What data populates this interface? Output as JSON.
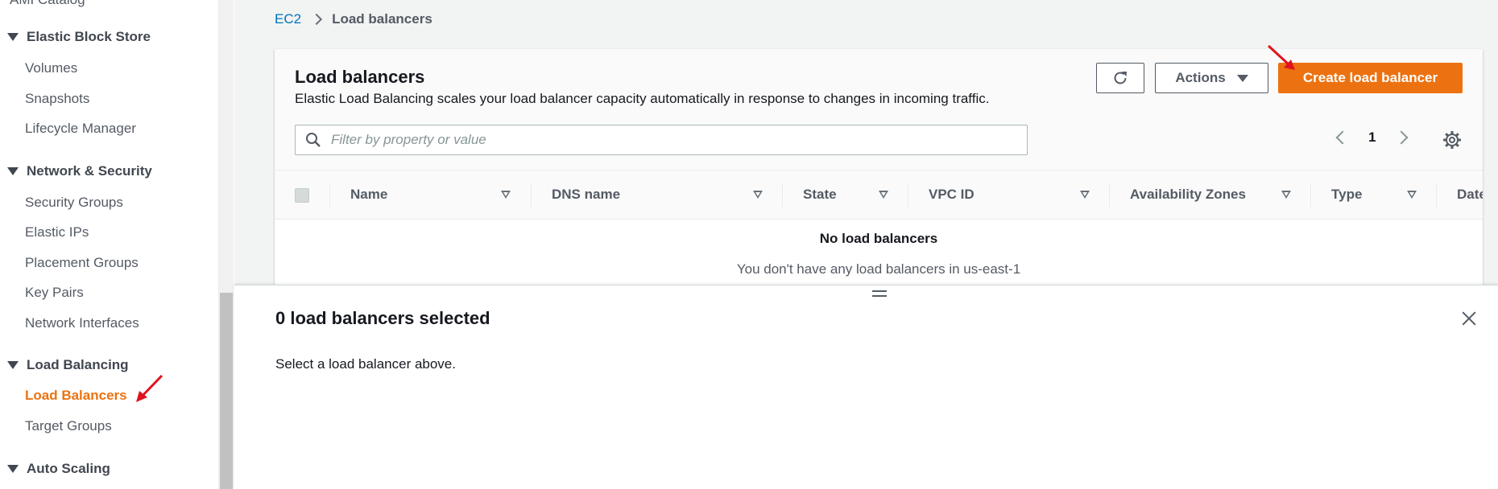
{
  "sidebar": {
    "clipped_item": "AMI Catalog",
    "sections": [
      {
        "title": "Elastic Block Store",
        "items": [
          "Volumes",
          "Snapshots",
          "Lifecycle Manager"
        ]
      },
      {
        "title": "Network & Security",
        "items": [
          "Security Groups",
          "Elastic IPs",
          "Placement Groups",
          "Key Pairs",
          "Network Interfaces"
        ]
      },
      {
        "title": "Load Balancing",
        "items": [
          "Load Balancers",
          "Target Groups"
        ]
      },
      {
        "title": "Auto Scaling",
        "items": []
      }
    ],
    "active_item": "Load Balancers"
  },
  "breadcrumb": {
    "root": "EC2",
    "current": "Load balancers"
  },
  "panel": {
    "title": "Load balancers",
    "description": "Elastic Load Balancing scales your load balancer capacity automatically in response to changes in incoming traffic.",
    "actions_label": "Actions",
    "create_label": "Create load balancer",
    "filter_placeholder": "Filter by property or value",
    "page": "1"
  },
  "table": {
    "columns": [
      "Name",
      "DNS name",
      "State",
      "VPC ID",
      "Availability Zones",
      "Type",
      "Date"
    ],
    "empty_title": "No load balancers",
    "empty_message": "You don't have any load balancers in us-east-1"
  },
  "split_panel": {
    "title": "0 load balancers selected",
    "message": "Select a load balancer above."
  },
  "colors": {
    "accent": "#ec7211",
    "link": "#0073bb",
    "annotation_arrow": "#e0141e"
  }
}
